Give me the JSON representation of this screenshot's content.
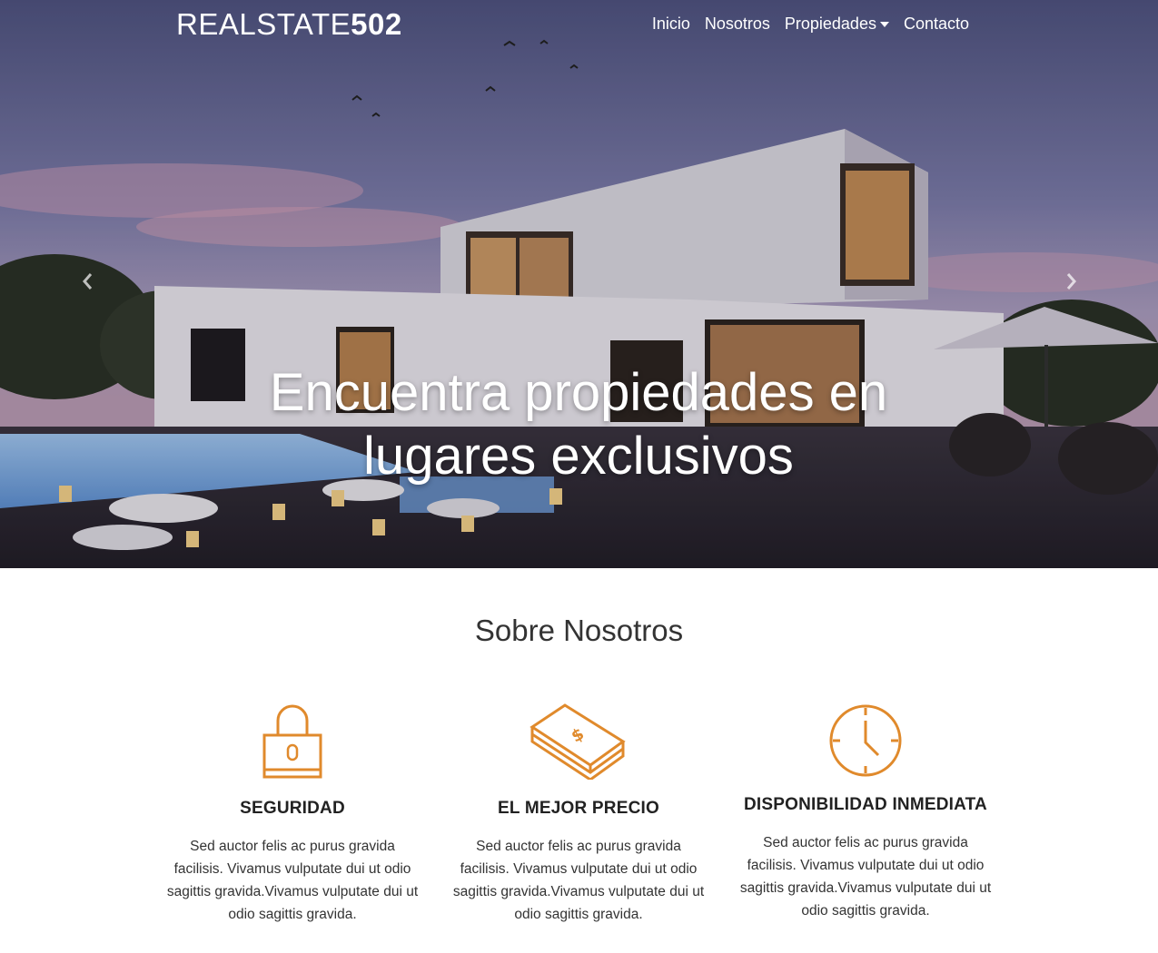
{
  "nav": {
    "brand_light": "REALSTATE",
    "brand_bold": "502",
    "links": [
      {
        "label": "Inicio"
      },
      {
        "label": "Nosotros"
      },
      {
        "label": "Propiedades",
        "dropdown": true
      },
      {
        "label": "Contacto"
      }
    ]
  },
  "hero": {
    "title": "Encuentra propiedades en lugares exclusivos",
    "prev_icon": "chevron-left-icon",
    "next_icon": "chevron-right-icon"
  },
  "about": {
    "title": "Sobre Nosotros",
    "features": [
      {
        "icon": "lock-icon",
        "heading": "SEGURIDAD",
        "text": "Sed auctor felis ac purus gravida facilisis. Vivamus vulputate dui ut odio sagittis gravida.Vivamus vulputate dui ut odio sagittis gravida."
      },
      {
        "icon": "money-icon",
        "heading": "EL MEJOR PRECIO",
        "text": "Sed auctor felis ac purus gravida facilisis. Vivamus vulputate dui ut odio sagittis gravida.Vivamus vulputate dui ut odio sagittis gravida."
      },
      {
        "icon": "clock-icon",
        "heading": "DISPONIBILIDAD INMEDIATA",
        "text": "Sed auctor felis ac purus gravida facilisis. Vivamus vulputate dui ut odio sagittis gravida.Vivamus vulputate dui ut odio sagittis gravida."
      }
    ]
  },
  "colors": {
    "accent": "#e08a2c",
    "sky_top": "#5a5f8c",
    "ground": "#2a2630"
  }
}
